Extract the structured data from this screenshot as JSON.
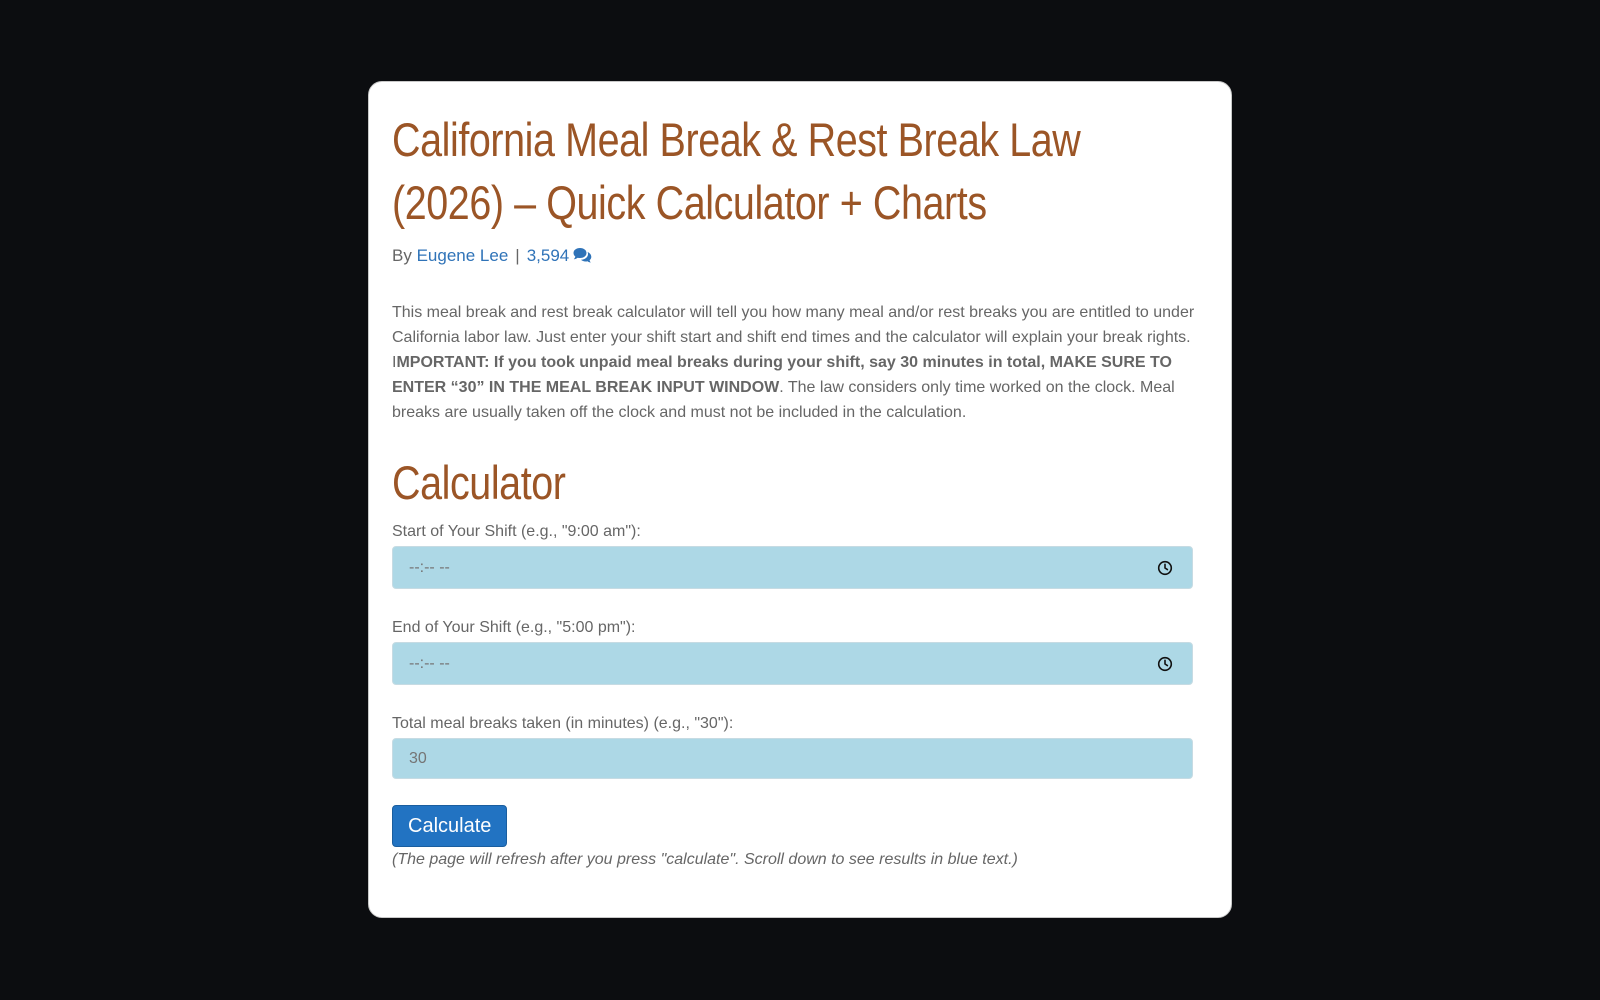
{
  "article": {
    "title": "California Meal Break & Rest Break Law (2026) – Quick Calculator + Charts",
    "byline_prefix": "By",
    "author": "Eugene Lee",
    "separator": "|",
    "comment_count": "3,594",
    "intro_part1": "This meal break and rest break calculator will tell you how many meal and/or rest breaks you are entitled to under California labor law. Just enter your shift start and shift end times and the calculator will explain your break rights. I",
    "intro_bold": "MPORTANT: If you took unpaid meal breaks during your shift, say 30 minutes in total, MAKE SURE TO ENTER “30” IN THE MEAL BREAK INPUT WINDOW",
    "intro_part2": ". The law considers only time worked on the clock. Meal breaks are usually taken off the clock and must not be included in the calculation."
  },
  "calculator": {
    "heading": "Calculator",
    "start_label": "Start of Your Shift (e.g., \"9:00 am\"):",
    "start_placeholder": "--:-- --",
    "end_label": "End of Your Shift (e.g., \"5:00 pm\"):",
    "end_placeholder": "--:-- --",
    "meal_label": "Total meal breaks taken (in minutes) (e.g., \"30\"):",
    "meal_placeholder": "30",
    "button_label": "Calculate",
    "note": "(The page will refresh after you press \"calculate\". Scroll down to see results in blue text.)"
  },
  "icons": {
    "comments": "comments-icon",
    "clock": "clock-icon"
  },
  "colors": {
    "background": "#0c0d10",
    "heading": "#9b5526",
    "link": "#2f73b8",
    "input_bg": "#add8e6",
    "button": "#2273c2"
  }
}
